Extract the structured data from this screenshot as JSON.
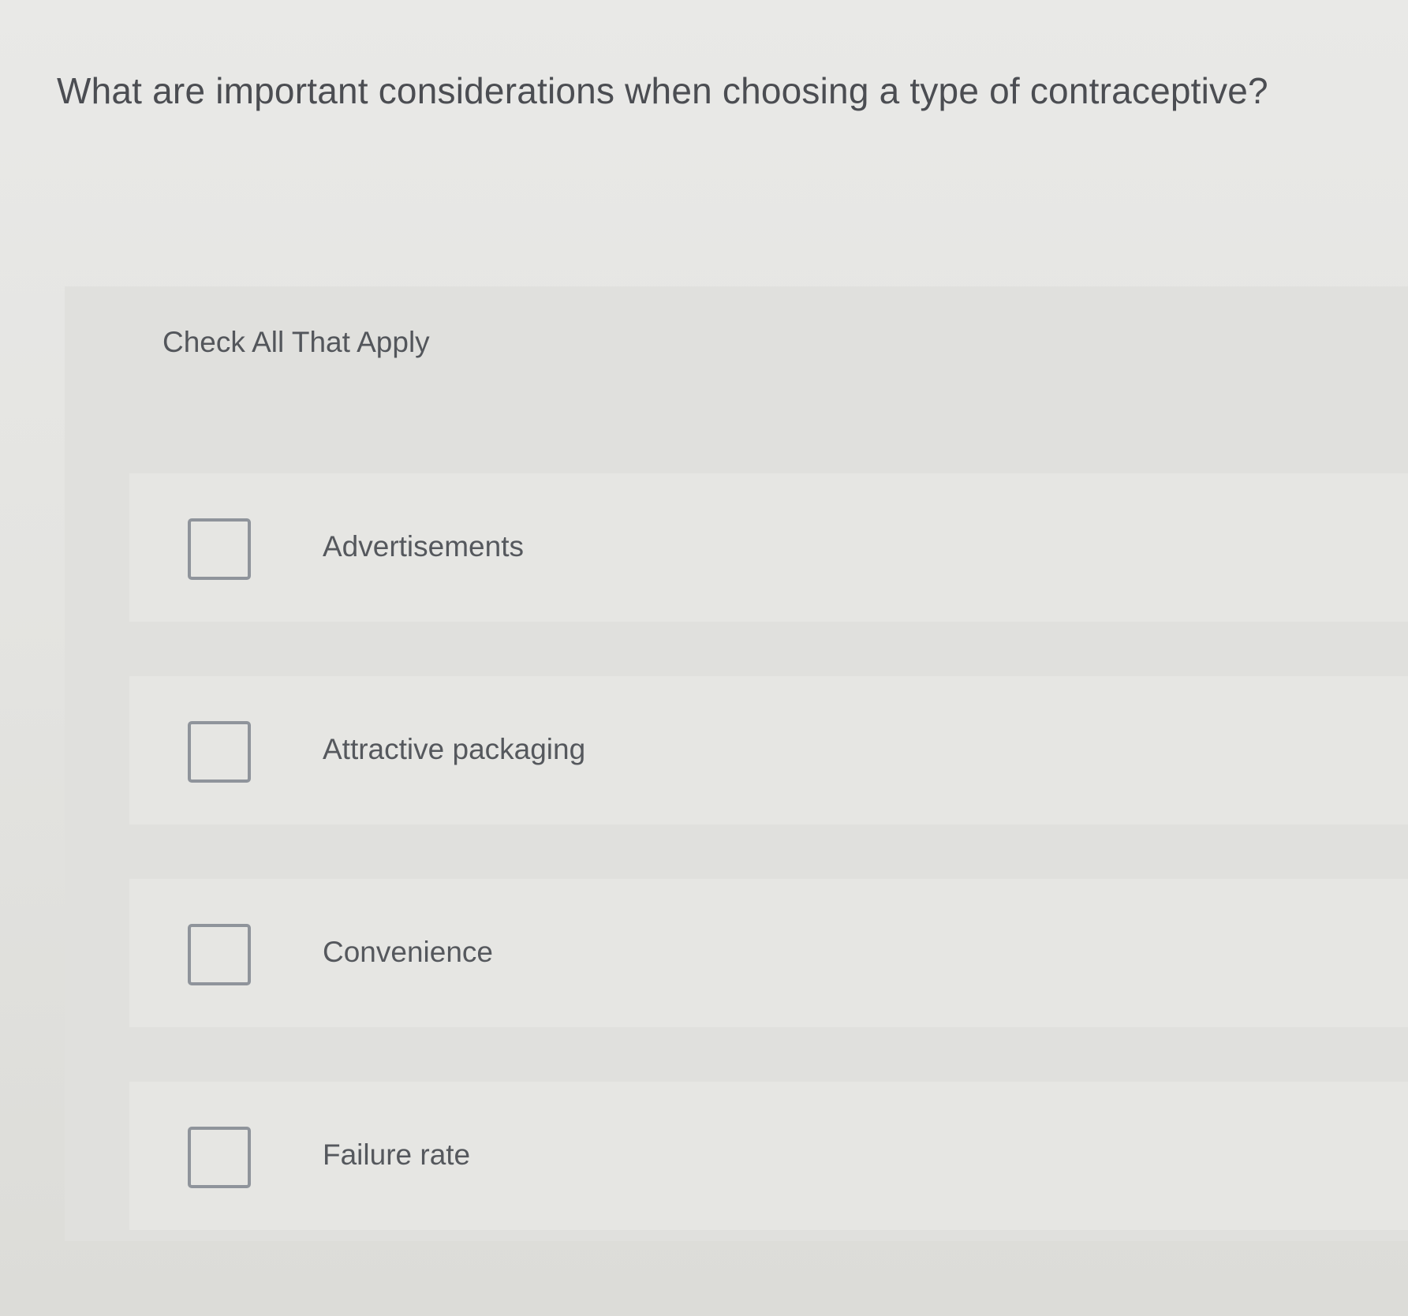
{
  "question": {
    "text": "What are important considerations when choosing a type of contraceptive?"
  },
  "panel": {
    "instruction": "Check All That Apply",
    "options": [
      {
        "label": "Advertisements",
        "checked": false
      },
      {
        "label": "Attractive packaging",
        "checked": false
      },
      {
        "label": "Convenience",
        "checked": false
      },
      {
        "label": "Failure rate",
        "checked": false
      }
    ]
  },
  "colors": {
    "background": "#e6e6e3",
    "panel": "#e0e0dd",
    "text": "#4b4d52",
    "checkbox_border": "#8f949b"
  }
}
